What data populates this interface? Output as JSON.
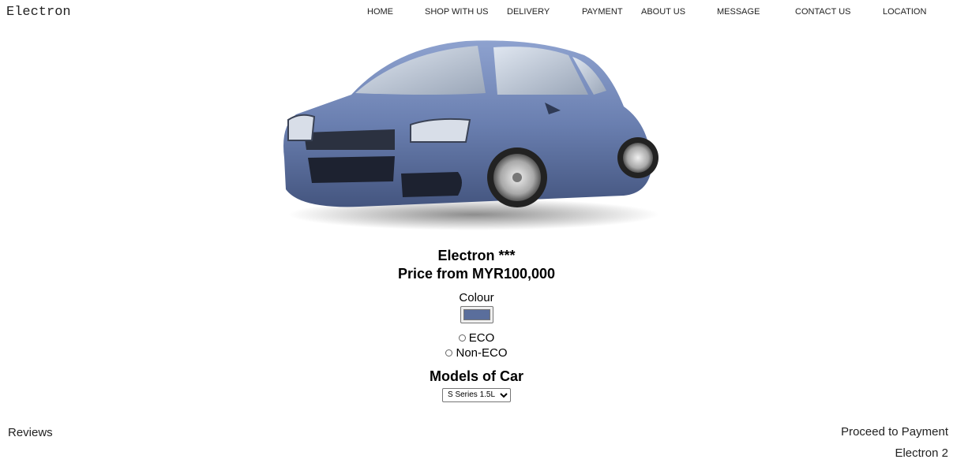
{
  "brand": "Electron",
  "nav": {
    "items": [
      "HOME",
      "SHOP WITH US",
      "DELIVERY",
      "PAYMENT",
      "ABOUT US",
      "MESSAGE",
      "CONTACT US",
      "LOCATION"
    ]
  },
  "product": {
    "name": "Electron ***",
    "price": "Price from MYR100,000",
    "colour_label": "Colour",
    "colour_value": "#5a6e9c",
    "options": {
      "eco": "ECO",
      "non_eco": "Non-ECO"
    },
    "models_title": "Models of Car",
    "model_selected": "S Series 1.5L"
  },
  "footer": {
    "reviews": "Reviews",
    "proceed": "Proceed to Payment",
    "brand2": "Electron 2"
  },
  "colors": {
    "car_body": "#6a7fb0",
    "swatch": "#5a6e9c"
  }
}
